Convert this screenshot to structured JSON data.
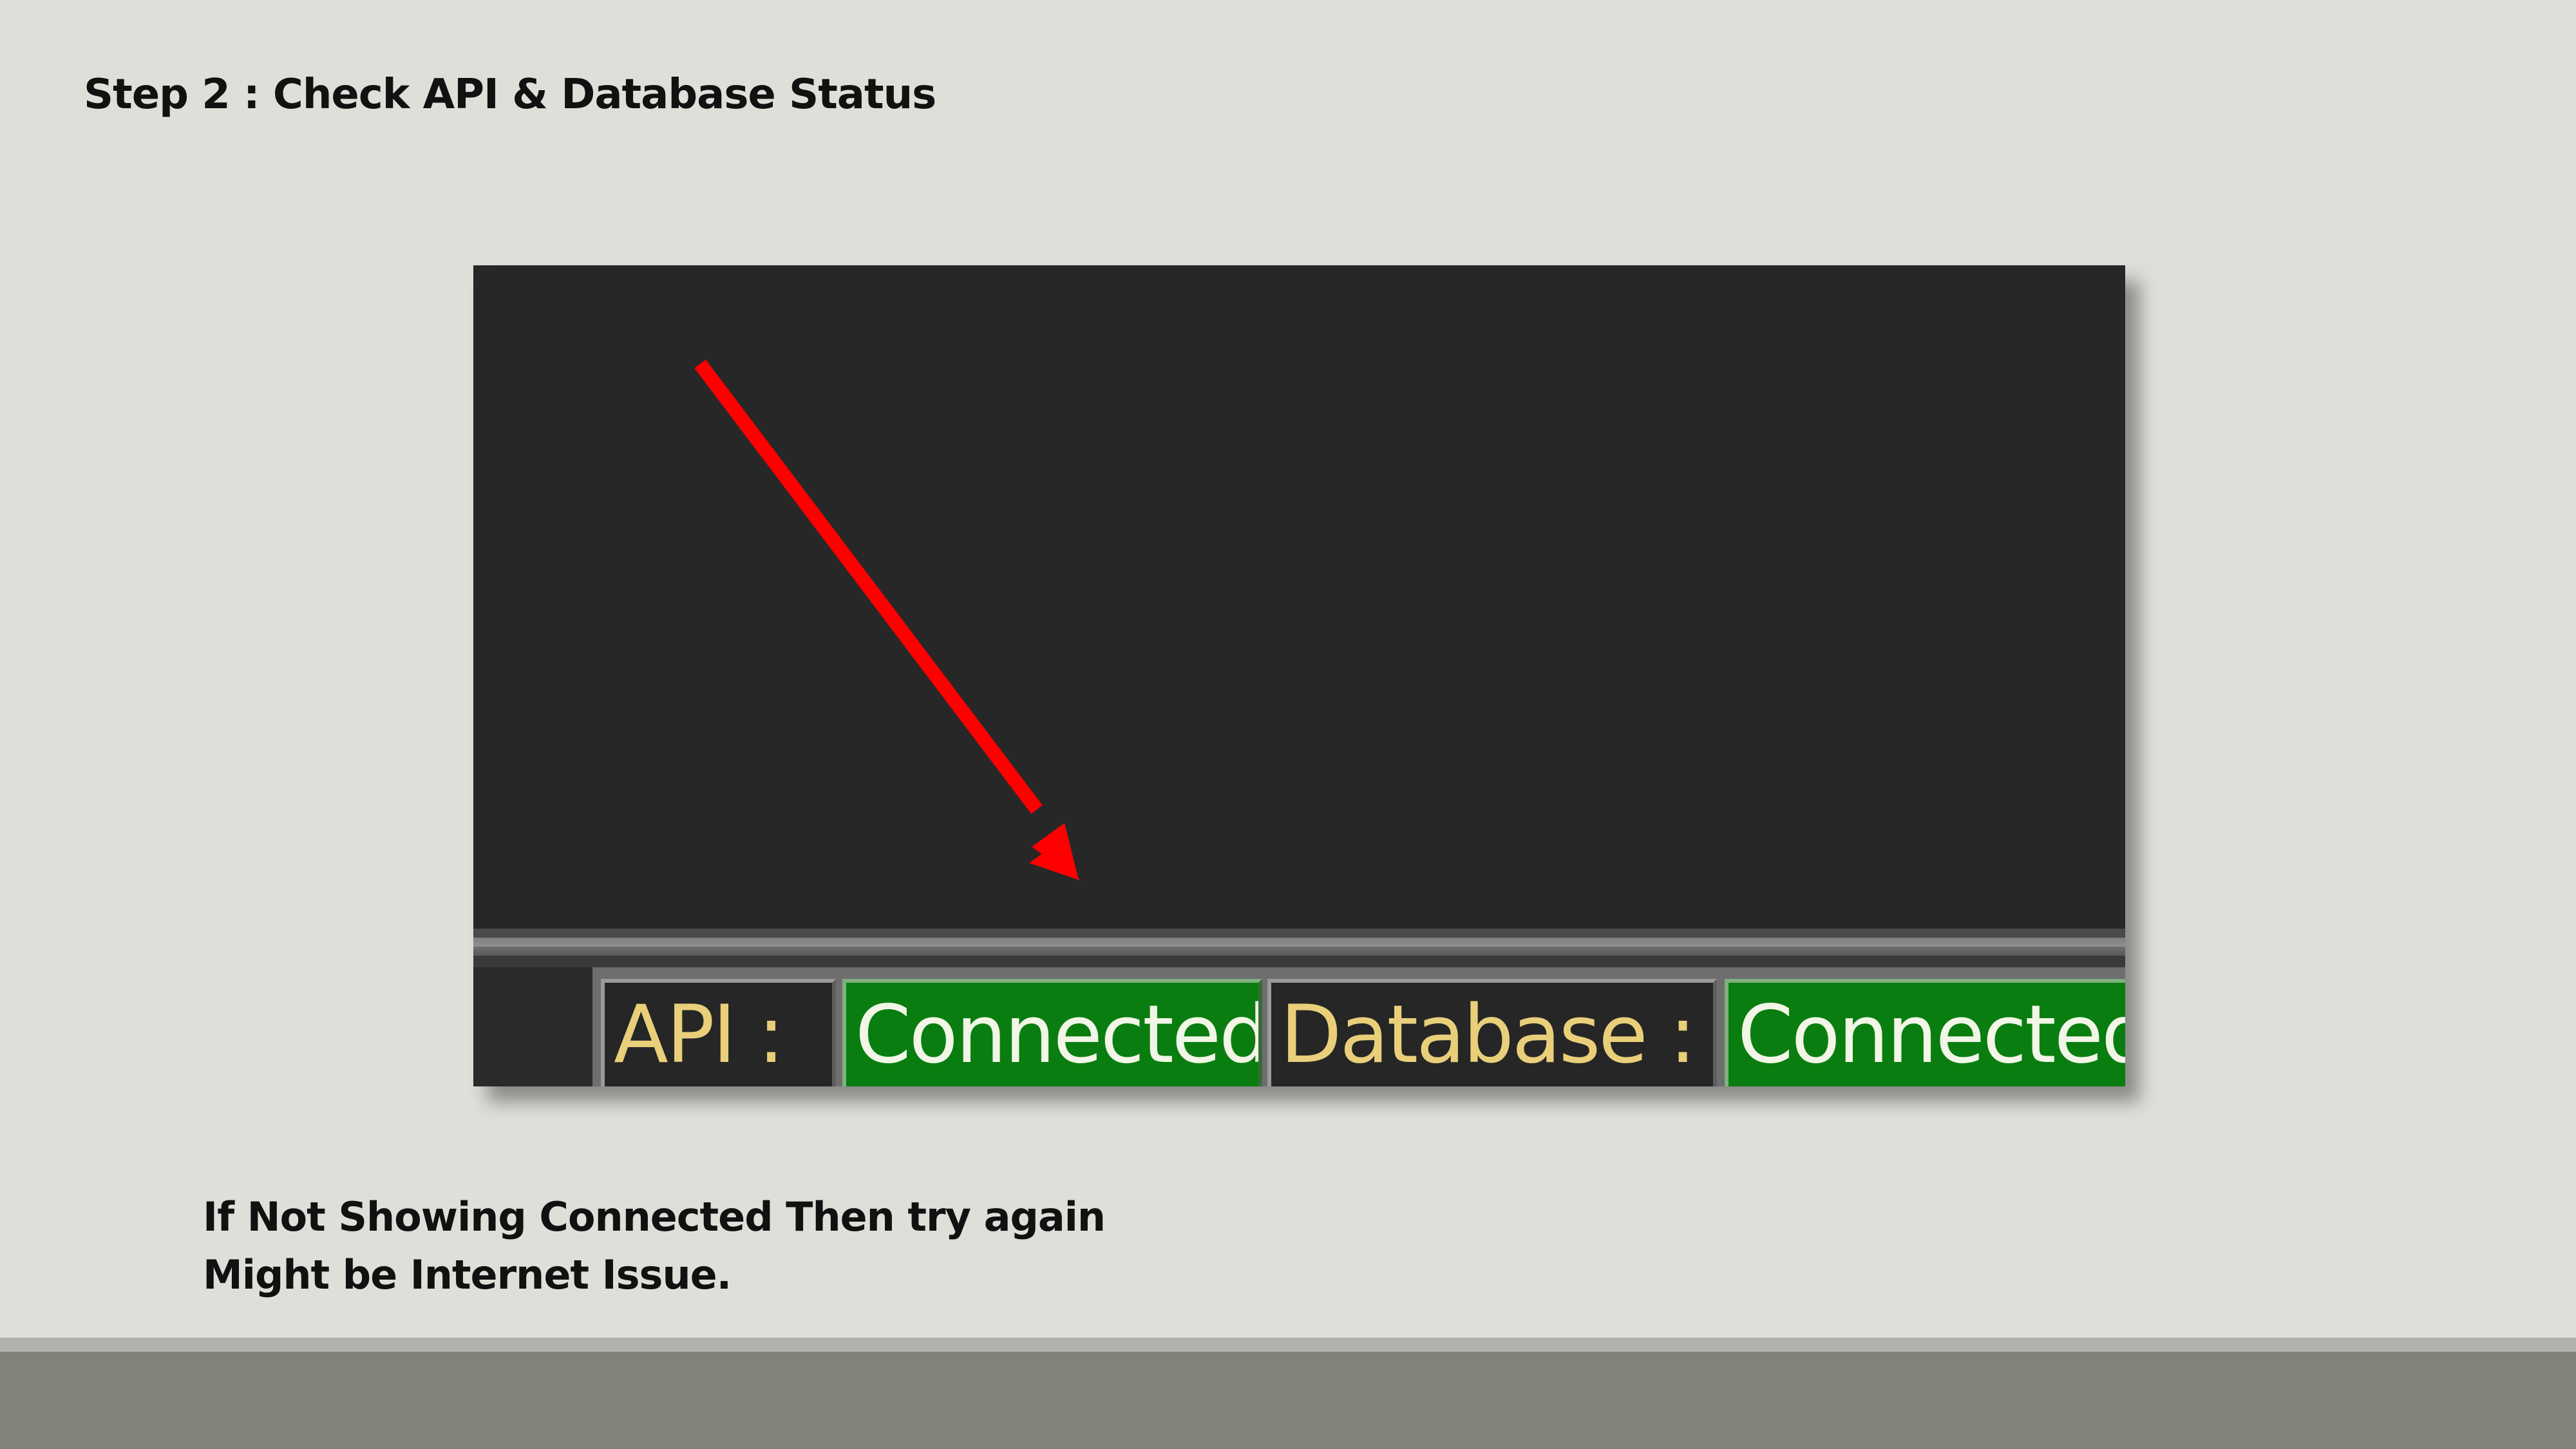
{
  "slide": {
    "title": "Step 2 : Check API & Database Status"
  },
  "screenshot": {
    "status_bar": {
      "api_label": "API :",
      "api_value": "Connected",
      "database_label": "Database :",
      "database_value": "Connected"
    },
    "colors": {
      "connected_bg": "#0a7d10",
      "label_text": "#e9cf7a",
      "panel_bg": "#272727",
      "arrow": "#ff0000"
    }
  },
  "note": {
    "line1": "If Not Showing Connected Then try again",
    "line2": "Might be Internet Issue."
  },
  "theme": {
    "background": "#dfdfda",
    "footer": "#82827a"
  }
}
